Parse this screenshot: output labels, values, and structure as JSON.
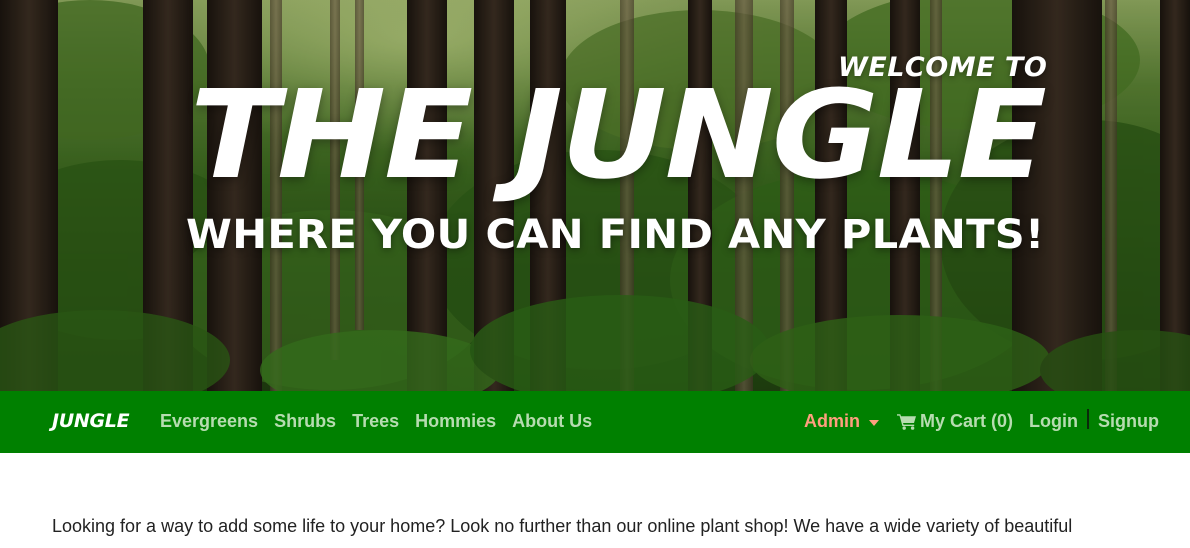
{
  "hero": {
    "welcome": "WELCOME TO",
    "title": "THE JUNGLE",
    "tagline": "WHERE YOU CAN FIND ANY PLANTS!"
  },
  "nav": {
    "brand": "JUNGLE",
    "links": [
      "Evergreens",
      "Shrubs",
      "Trees",
      "Hommies",
      "About Us"
    ],
    "admin_label": "Admin",
    "cart_label": "My Cart (0)",
    "login_label": "Login",
    "signup_label": "Signup",
    "icons": {
      "cart": "shopping-cart-icon",
      "admin_dropdown": "caret-down-icon"
    }
  },
  "content": {
    "intro": "Looking for a way to add some life to your home? Look no further than our online plant shop! We have a wide variety of beautiful"
  },
  "colors": {
    "navbar": "#008000",
    "nav_link": "#b6dcb0",
    "admin": "#ff9f7f",
    "brand": "#ffffff"
  }
}
